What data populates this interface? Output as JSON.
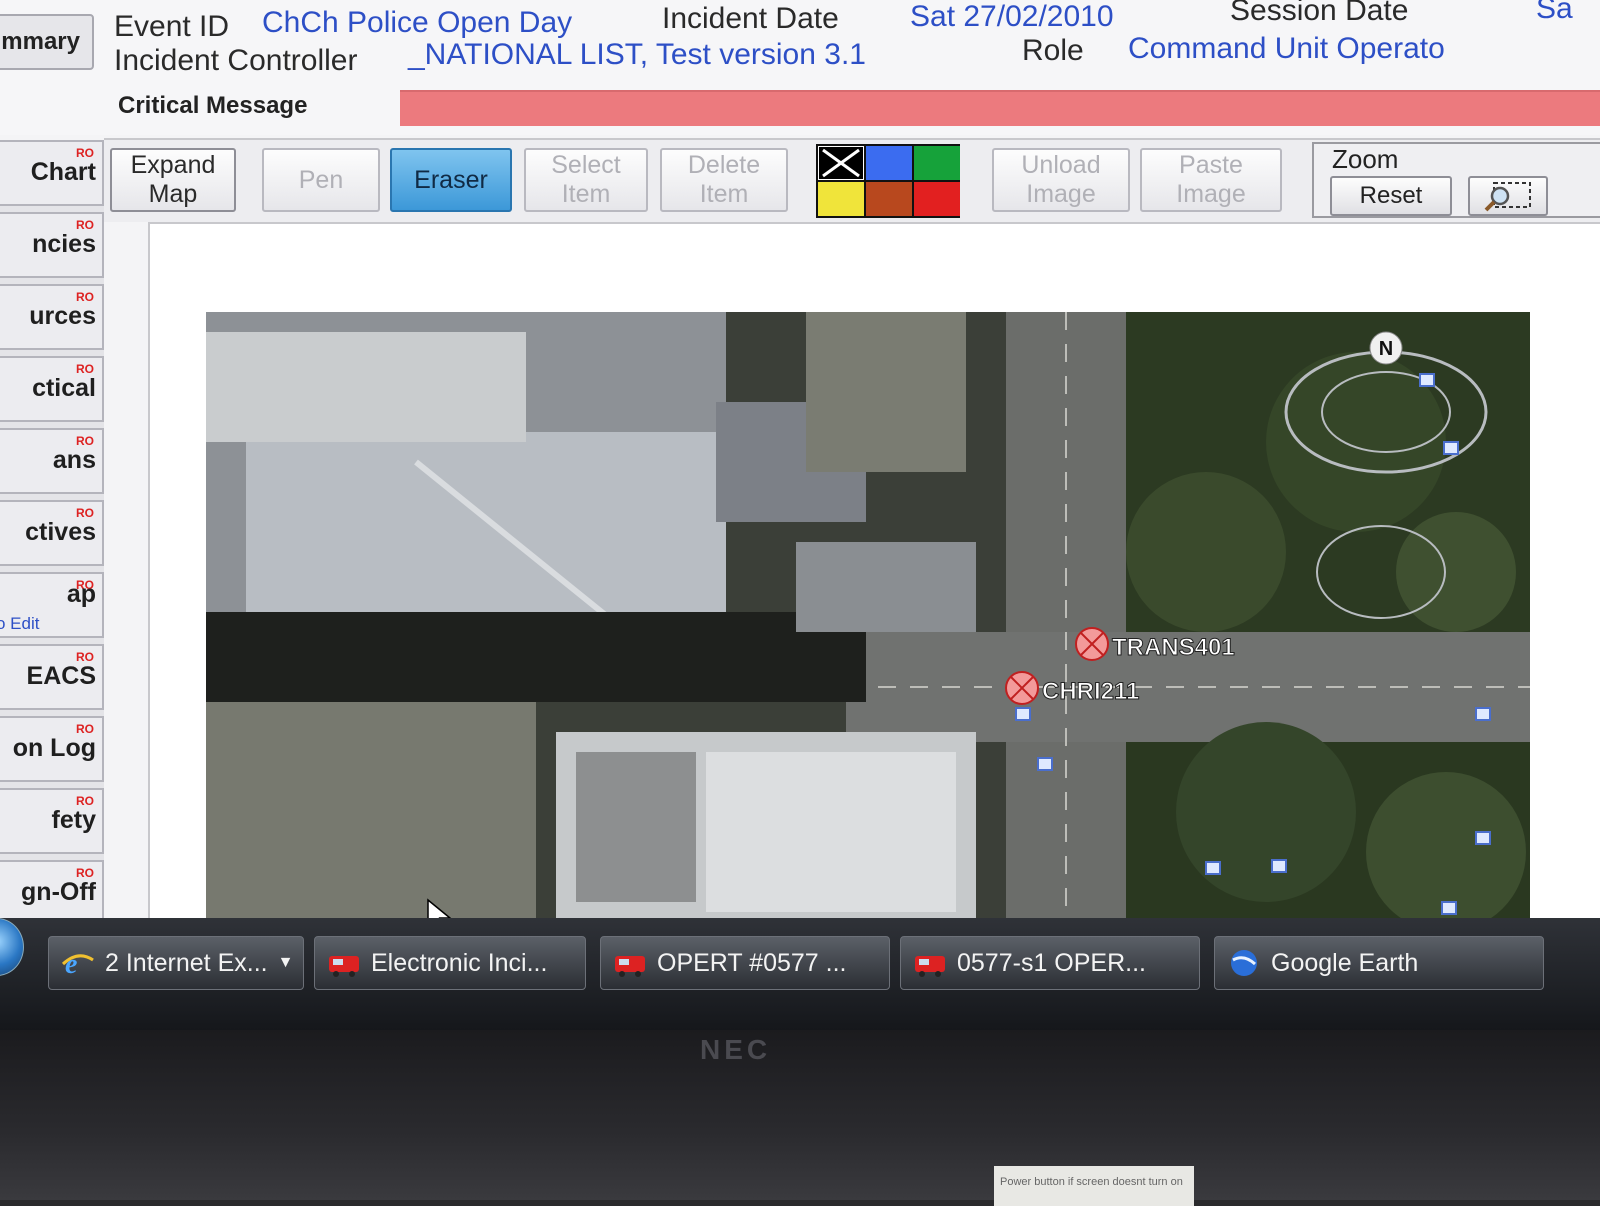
{
  "header": {
    "summary_tab": "mmary",
    "event_id_label": "Event ID",
    "event_id_value": "ChCh Police Open Day",
    "incident_date_label": "Incident Date",
    "incident_date_value": "Sat 27/02/2010",
    "session_date_label": "Session Date",
    "session_date_value": "Sa",
    "incident_controller_label": "Incident Controller",
    "incident_controller_value": "_NATIONAL LIST, Test version 3.1",
    "role_label": "Role",
    "role_value": "Command Unit Operato",
    "critical_message_label": "Critical Message"
  },
  "toolbar": {
    "expand_map": [
      "Expand",
      "Map"
    ],
    "pen": "Pen",
    "eraser": "Eraser",
    "select_item": [
      "Select",
      "Item"
    ],
    "delete_item": [
      "Delete",
      "Item"
    ],
    "unload_image": [
      "Unload",
      "Image"
    ],
    "paste_image": [
      "Paste",
      "Image"
    ],
    "zoom_label": "Zoom",
    "zoom_reset": "Reset",
    "palette": [
      "#000000",
      "#3b6cf0",
      "#16a23a",
      "#f0e43a",
      "#b8481e",
      "#e22020"
    ]
  },
  "sidebar": {
    "ro_badge": "RO",
    "items": [
      {
        "label": "Chart"
      },
      {
        "label": "ncies"
      },
      {
        "label": "urces"
      },
      {
        "label": "ctical"
      },
      {
        "label": "ans"
      },
      {
        "label": "ctives"
      },
      {
        "label": "ap",
        "sub": "o Edit"
      },
      {
        "label": "EACS"
      },
      {
        "label": "on Log"
      },
      {
        "label": "fety"
      },
      {
        "label": "gn-Off"
      }
    ]
  },
  "map": {
    "north_label": "N",
    "markers": [
      {
        "label": "TRANS401"
      },
      {
        "label": "CHRI211"
      }
    ]
  },
  "taskbar": {
    "items": [
      {
        "label": "2 Internet Ex..."
      },
      {
        "label": "Electronic Inci..."
      },
      {
        "label": "OPERT #0577 ..."
      },
      {
        "label": "0577-s1 OPER..."
      },
      {
        "label": "Google Earth"
      }
    ]
  },
  "bezel": {
    "brand": "NEC",
    "sticker": "Power button if screen doesnt turn on"
  }
}
